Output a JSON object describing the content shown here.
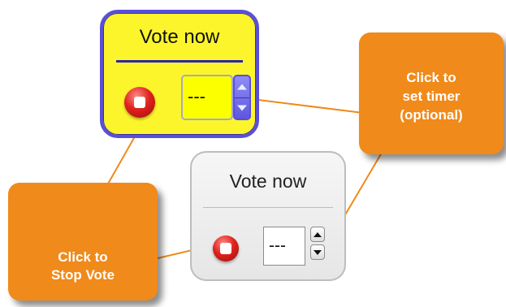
{
  "widgets": {
    "yellow": {
      "title": "Vote now",
      "timer_value": "---"
    },
    "grey": {
      "title": "Vote now",
      "timer_value": "---"
    }
  },
  "callouts": {
    "timer": "Click to\nset timer\n(optional)",
    "stop": "Click to\nStop Vote"
  },
  "icons": {
    "stop": "stop-icon",
    "spin_up": "chevron-up-icon",
    "spin_down": "chevron-down-icon"
  },
  "colors": {
    "callout": "#f08a1a",
    "connector": "#f08a1a",
    "yellow_widget_bg": "#fdf52c",
    "yellow_widget_border": "#5a4fd6",
    "stop_button": "#e0231d"
  }
}
